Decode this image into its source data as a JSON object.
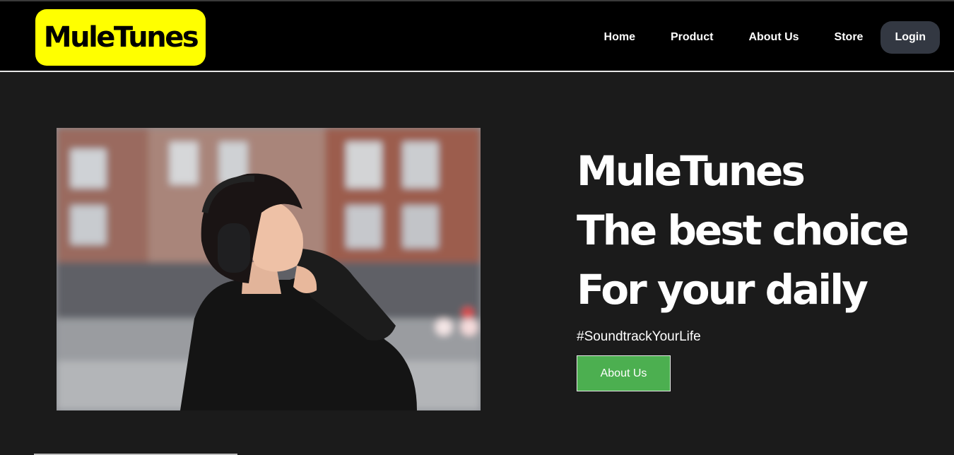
{
  "header": {
    "logo_text": "MuleTunes",
    "nav": {
      "home": "Home",
      "product": "Product",
      "about": "About Us",
      "store": "Store",
      "login": "Login"
    }
  },
  "hero": {
    "title_line1": "MuleTunes",
    "title_line2": "The best choice",
    "title_line3": "For your daily",
    "tagline": "#SoundtrackYourLife",
    "button_label": "About Us"
  },
  "colors": {
    "background": "#1b1b1b",
    "navbar": "#000000",
    "logo_bg": "#ffff00",
    "login_bg": "#333842",
    "button_bg": "#4caf50"
  }
}
